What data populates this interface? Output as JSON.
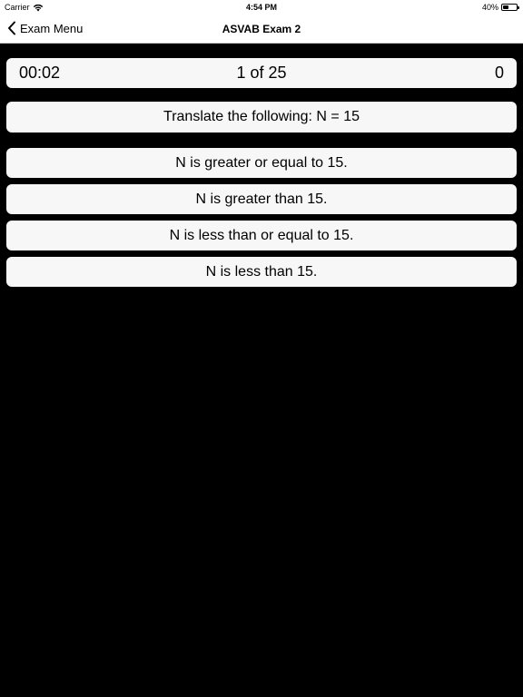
{
  "status_bar": {
    "carrier": "Carrier",
    "time": "4:54 PM",
    "battery_percent": "40%",
    "battery_level": 0.4
  },
  "nav": {
    "back_label": "Exam Menu",
    "title": "ASVAB Exam 2"
  },
  "scorebar": {
    "timer": "00:02",
    "progress": "1 of 25",
    "score": "0"
  },
  "question": {
    "text": "Translate the following: N = 15"
  },
  "answers": [
    {
      "label": "N is greater or equal to 15."
    },
    {
      "label": "N is greater than 15."
    },
    {
      "label": "N is less than or equal to 15."
    },
    {
      "label": "N is less than 15."
    }
  ]
}
